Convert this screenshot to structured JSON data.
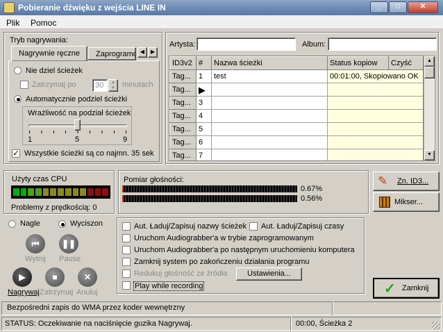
{
  "window": {
    "title": "Pobieranie dźwięku z wejścia LINE IN"
  },
  "menu": {
    "file": "Plik",
    "help": "Pomoc"
  },
  "record_mode": {
    "group_label": "Tryb nagrywania:",
    "tab_manual": "Nagrywnie ręczne",
    "tab_scheduled": "Zaprogramo",
    "no_split": "Nie dziel ścieżek",
    "stop_after": "Zatrzymaj po",
    "stop_minutes": "30",
    "minutes_label": "minutach",
    "auto_split": "Automatycznie podziel ścieżki",
    "sensitivity_label": "Wrażliwość na podział ścieżek",
    "tick1": "1",
    "tick5": "5",
    "tick9": "9",
    "sensitivity_value": 5,
    "min35": "Wszystkie ścieżki są co najmn. 35 sek"
  },
  "meta": {
    "artist_label": "Artysta:",
    "artist_value": "",
    "album_label": "Album:",
    "album_value": ""
  },
  "table": {
    "headers": [
      "ID3v2",
      "#",
      "Nazwa ścieżki",
      "Status kopiow",
      "Czyść"
    ],
    "rows": [
      {
        "tag": "Tag...",
        "num": "1",
        "name": "test",
        "status": "00:01:00,  Skopiowano OK"
      },
      {
        "tag": "Tag...",
        "num": "",
        "name": "",
        "status": ""
      },
      {
        "tag": "Tag...",
        "num": "3",
        "name": "",
        "status": ""
      },
      {
        "tag": "Tag...",
        "num": "4",
        "name": "",
        "status": ""
      },
      {
        "tag": "Tag...",
        "num": "5",
        "name": "",
        "status": ""
      },
      {
        "tag": "Tag...",
        "num": "6",
        "name": "",
        "status": ""
      },
      {
        "tag": "Tag...",
        "num": "7",
        "name": "",
        "status": ""
      }
    ]
  },
  "cpu": {
    "label": "Użyty czas CPU",
    "problems": "Problemy z prędkością: 0"
  },
  "volume": {
    "label": "Pomiar głośności:",
    "left_pct": "0.67%",
    "right_pct": "0.56%"
  },
  "buttons": {
    "id3": "Zn. ID3...",
    "mixer": "Mikser...",
    "close": "Zamknij",
    "settings": "Ustawienia...",
    "mute": "Wytnij",
    "pause": "Pause",
    "record": "Nagrywaj",
    "stop": "Zatrzymaj",
    "cancel": "Anuluj"
  },
  "mode": {
    "loud": "Nagle",
    "quiet": "Wyciszon"
  },
  "options": {
    "auto_names": "Aut. Ładuj/Zapisuj nazwy ścieżek",
    "auto_times": "Aut. Ładuj/Zapisuj czasy",
    "run_scheduled": "Uruchom Audiograbber'a w trybie zaprogramowanym",
    "run_next": "Uruchom Audiograbber'a po następnym uruchomieniu komputera",
    "shutdown": "Zamknij system po zakończeniu działania programu",
    "reduce": "Redukuj głośność ze źródła",
    "play": "Play while recording"
  },
  "status": {
    "info": "Bezpośredni zapis do WMA przez koder wewnętrzny",
    "status": "STATUS: Oczekiwanie na naciśnięcie guzika Nagrywaj.",
    "time": "00:00, Ścieżka 2"
  },
  "colors": {
    "meter_green": "#00b000",
    "meter_yellow": "#8a8a20",
    "meter_red": "#8a1010",
    "title_bg": "#6f8fb8"
  }
}
